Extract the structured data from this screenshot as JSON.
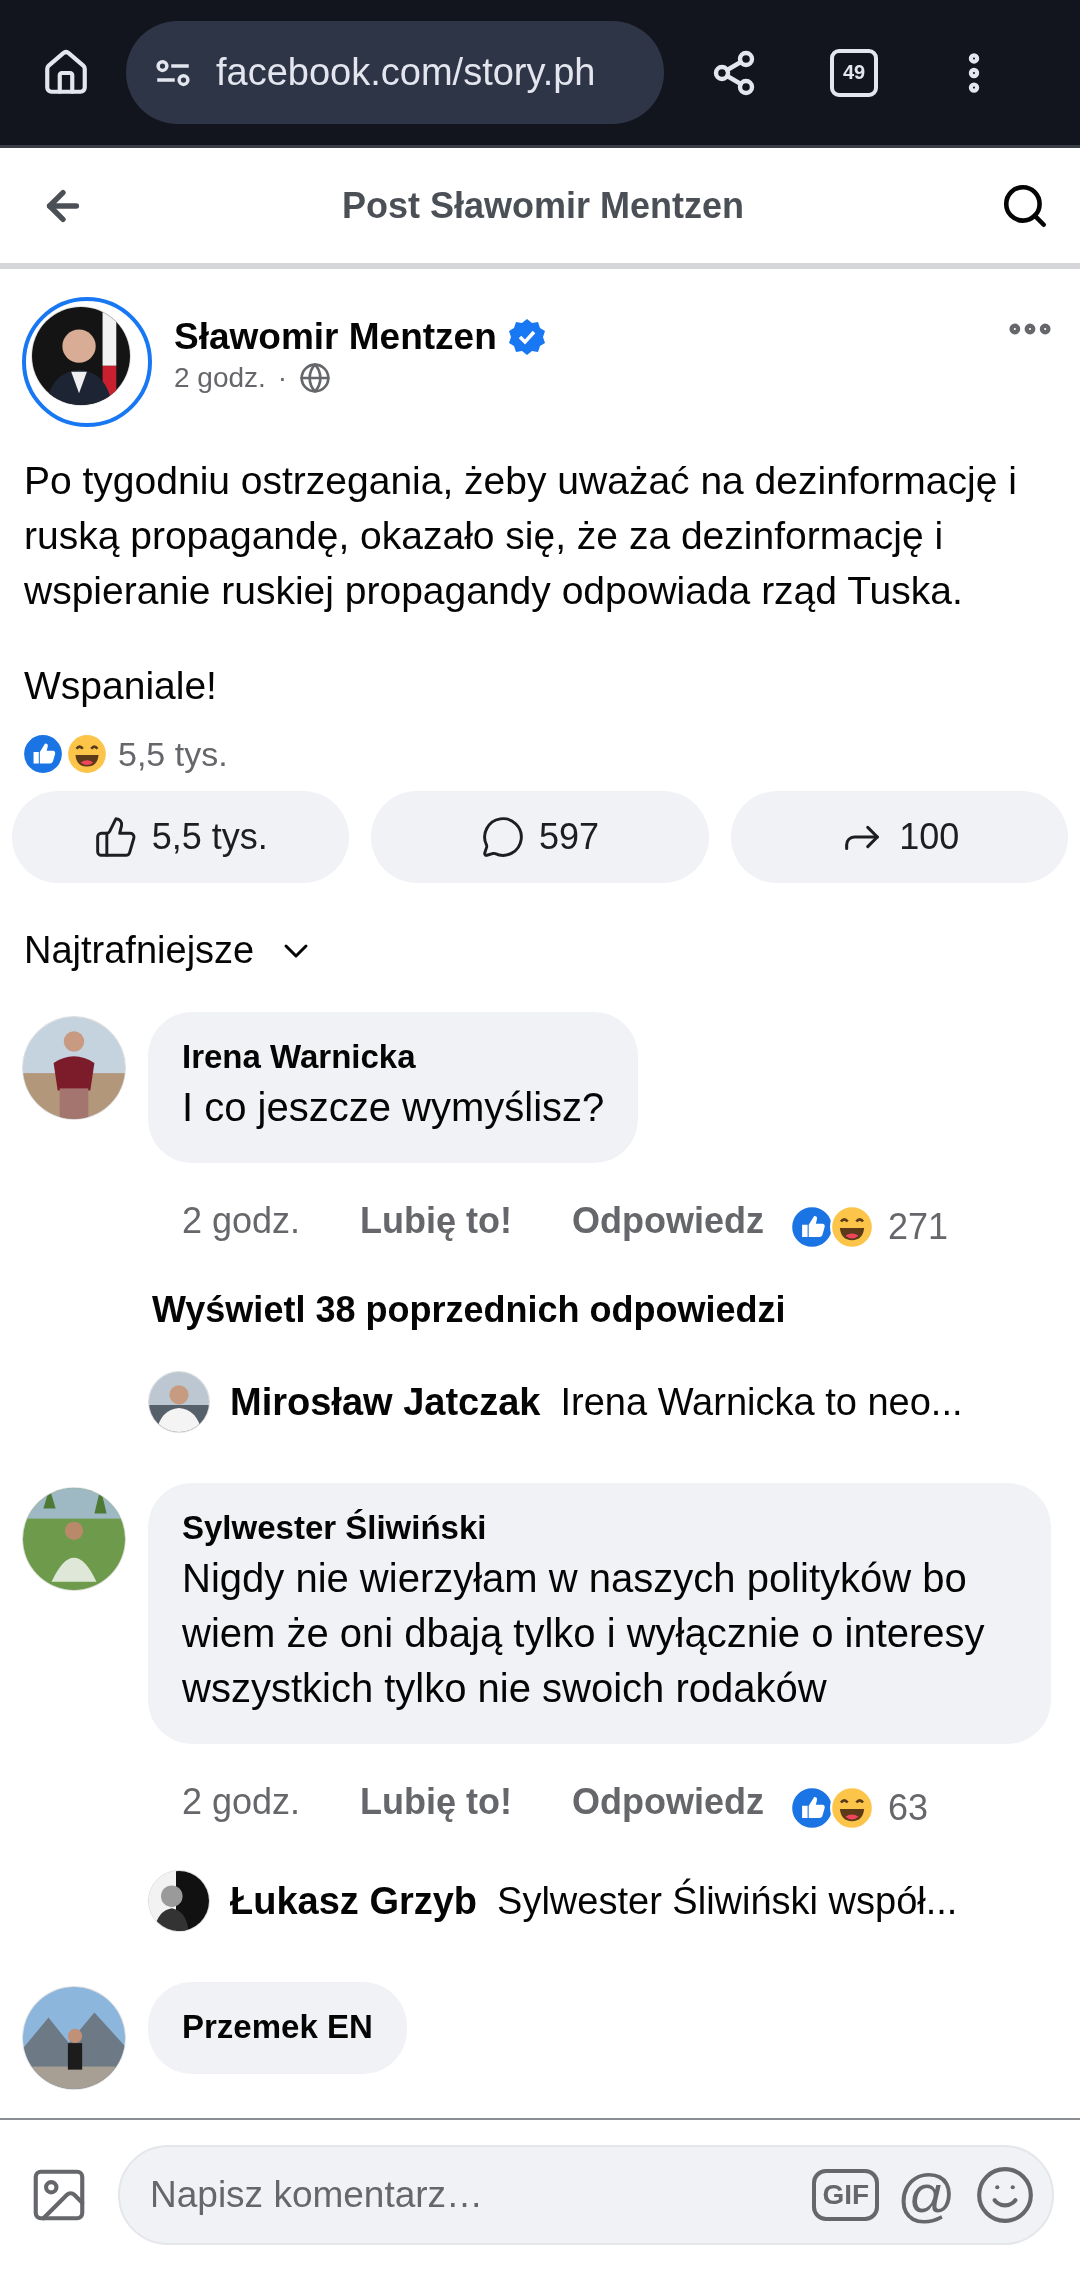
{
  "browser": {
    "url": "facebook.com/story.ph",
    "tab_count": "49"
  },
  "header": {
    "title": "Post Sławomir Mentzen"
  },
  "post": {
    "author": "Sławomir Mentzen",
    "verified": true,
    "time": "2 godz.",
    "separator": "·",
    "paragraphs": [
      "Po tygodniu ostrzegania, żeby uważać na dezinformację i ruską propagandę, okazało się, że za dezinformację i wspieranie ruskiej propagandy odpowiada rząd Tuska.",
      "Wspaniale!"
    ],
    "reaction_summary": "5,5 tys.",
    "actions": [
      {
        "kind": "like",
        "label": "5,5 tys."
      },
      {
        "kind": "comment",
        "label": "597"
      },
      {
        "kind": "share",
        "label": "100"
      }
    ]
  },
  "sort": {
    "label": "Najtrafniejsze"
  },
  "comments": [
    {
      "author": "Irena Warnicka",
      "text": "I co jeszcze wymyślisz?",
      "time": "2 godz.",
      "like": "Lubię to!",
      "reply": "Odpowiedz",
      "reactions": "271",
      "more_replies": "Wyświetl 38 poprzednich odpowiedzi",
      "reply_preview": {
        "author": "Mirosław Jatczak",
        "text": "Irena Warnicka to neo..."
      }
    },
    {
      "author": "Sylwester Śliwiński",
      "text": "Nigdy nie wierzyłam w naszych polityków bo wiem że oni dbają tylko i wyłącznie o interesy wszystkich tylko nie swoich rodaków",
      "time": "2 godz.",
      "like": "Lubię to!",
      "reply": "Odpowiedz",
      "reactions": "63",
      "reply_preview": {
        "author": "Łukasz Grzyb",
        "text": "Sylwester Śliwiński współ..."
      }
    },
    {
      "author": "Przemek EN"
    }
  ],
  "composer": {
    "placeholder": "Napisz komentarz…",
    "gif": "GIF",
    "mention": "@"
  }
}
